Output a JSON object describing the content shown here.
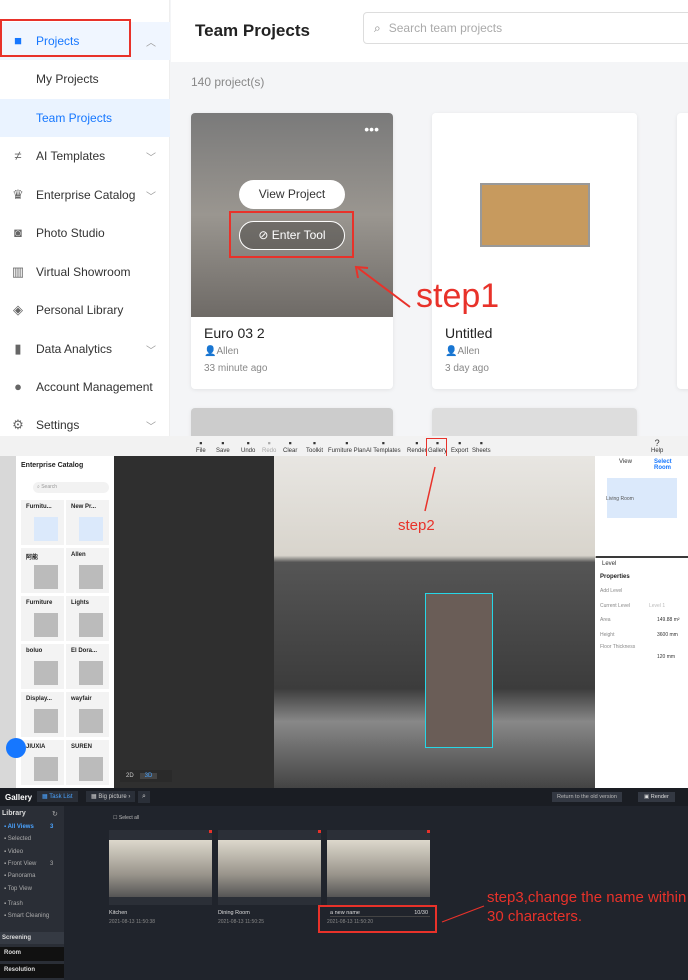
{
  "sidebar": {
    "items": [
      {
        "label": "Projects",
        "icon": "folder-icon",
        "expanded": true
      },
      {
        "label": "My Projects"
      },
      {
        "label": "Team Projects",
        "active": true
      },
      {
        "label": "AI Templates",
        "icon": "ai-icon"
      },
      {
        "label": "Enterprise Catalog",
        "icon": "crown-icon"
      },
      {
        "label": "Photo Studio",
        "icon": "camera-icon"
      },
      {
        "label": "Virtual Showroom",
        "icon": "showroom-icon"
      },
      {
        "label": "Personal Library",
        "icon": "box-icon"
      },
      {
        "label": "Data Analytics",
        "icon": "chart-icon"
      },
      {
        "label": "Account Management",
        "icon": "user-icon"
      },
      {
        "label": "Settings",
        "icon": "gear-icon"
      }
    ]
  },
  "header": {
    "title": "Team Projects",
    "search_placeholder": "Search team projects"
  },
  "main": {
    "count": "140 project(s)",
    "projects": [
      {
        "name": "Euro 03 2",
        "owner": "Allen",
        "time": "33 minute ago",
        "view_label": "View Project",
        "enter_label": "Enter Tool"
      },
      {
        "name": "Untitled",
        "owner": "Allen",
        "time": "3 day ago"
      }
    ]
  },
  "annotations": {
    "step1": "step1",
    "step2": "step2",
    "step3": "step3,change the name within 30 characters."
  },
  "toolbar": {
    "items": [
      "File",
      "Save",
      "Undo",
      "Redo",
      "Clear",
      "Toolkit",
      "Furniture Plan",
      "AI Templates",
      "Render",
      "Gallery",
      "Export",
      "Sheets"
    ],
    "help": "Help"
  },
  "catalog": {
    "title": "Enterprise Catalog",
    "search_placeholder": "Search",
    "items": [
      "Furnitu...",
      "New Pr...",
      "阿能",
      "Allen",
      "Furniture",
      "Lights",
      "boluo",
      "El Dora...",
      "Display...",
      "wayfair",
      "JIUXIA",
      "SUREN"
    ]
  },
  "view_panel": {
    "view": "View",
    "select_room": "Select Room",
    "room": "Living Room"
  },
  "level": {
    "title": "Level",
    "properties": "Properties",
    "add_level": "Add Level",
    "current_level": "Current Level",
    "current_value": "Level 1",
    "area": "Area",
    "area_value": "149.88",
    "area_unit": "m²",
    "height": "Height",
    "height_value": "3600",
    "height_unit": "mm",
    "floor": "Floor Thickness",
    "floor_value": "120",
    "floor_unit": "mm"
  },
  "view_toggle": {
    "d2": "2D",
    "d3": "3D"
  },
  "gallery": {
    "title": "Gallery",
    "tab_task": "Task List",
    "tab_big": "Big picture",
    "old_version": "Return to the old version",
    "render": "Render",
    "library": "Library",
    "lib_items": [
      {
        "label": "All Views",
        "count": "3"
      },
      {
        "label": "Selected"
      },
      {
        "label": "Video"
      },
      {
        "label": "Front View",
        "count": "3"
      },
      {
        "label": "Panorama"
      },
      {
        "label": "Top View"
      },
      {
        "label": "Trash"
      },
      {
        "label": "Smart Cleaning"
      }
    ],
    "screening": "Screening",
    "room": "Room",
    "resolution": "Resolution",
    "select_all": "Select all",
    "images": [
      {
        "name": "Kitchen",
        "time": "2021-08-13 11:50:38"
      },
      {
        "name": "Dining Room",
        "time": "2021-08-13 11:50:25"
      },
      {
        "name": "a new name",
        "time": "2021-08-13 11:50:20",
        "counter": "10/30"
      }
    ]
  }
}
